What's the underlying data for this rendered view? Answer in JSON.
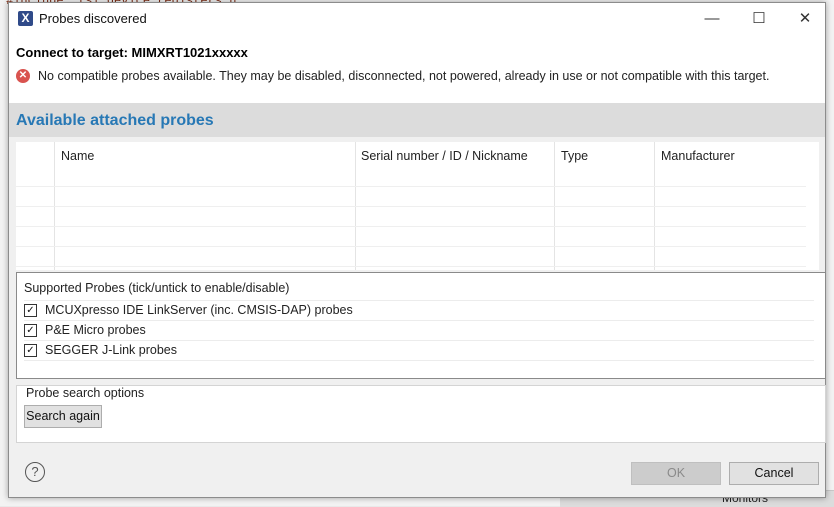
{
  "window": {
    "title": "Probes discovered",
    "minimize_glyph": "—",
    "maximize_glyph": "☐",
    "close_glyph": "✕"
  },
  "header": {
    "connect_title": "Connect to target: MIMXRT1021xxxxx",
    "error_message": "No compatible probes available. They may be disabled, disconnected, not powered, already in use or not compatible with this target."
  },
  "section": {
    "title": "Available attached probes"
  },
  "probe_table": {
    "columns": [
      "Name",
      "Serial number / ID / Nickname",
      "Type",
      "Manufacturer"
    ],
    "rows": []
  },
  "supported_probes": {
    "title": "Supported Probes (tick/untick to enable/disable)",
    "items": [
      {
        "label": "MCUXpresso IDE LinkServer (inc. CMSIS-DAP) probes",
        "checked": true
      },
      {
        "label": "P&E Micro probes",
        "checked": true
      },
      {
        "label": "SEGGER J-Link probes",
        "checked": true
      }
    ]
  },
  "search_options": {
    "title": "Probe search options",
    "search_button": "Search again"
  },
  "footer": {
    "help_glyph": "?",
    "ok_label": "OK",
    "cancel_label": "Cancel"
  },
  "background": {
    "code_snippet": "#include \"fsl_device_registers.h\"",
    "monitors_label": "Monitors"
  },
  "colors": {
    "section_title": "#2778b5",
    "error": "#d9534f"
  }
}
